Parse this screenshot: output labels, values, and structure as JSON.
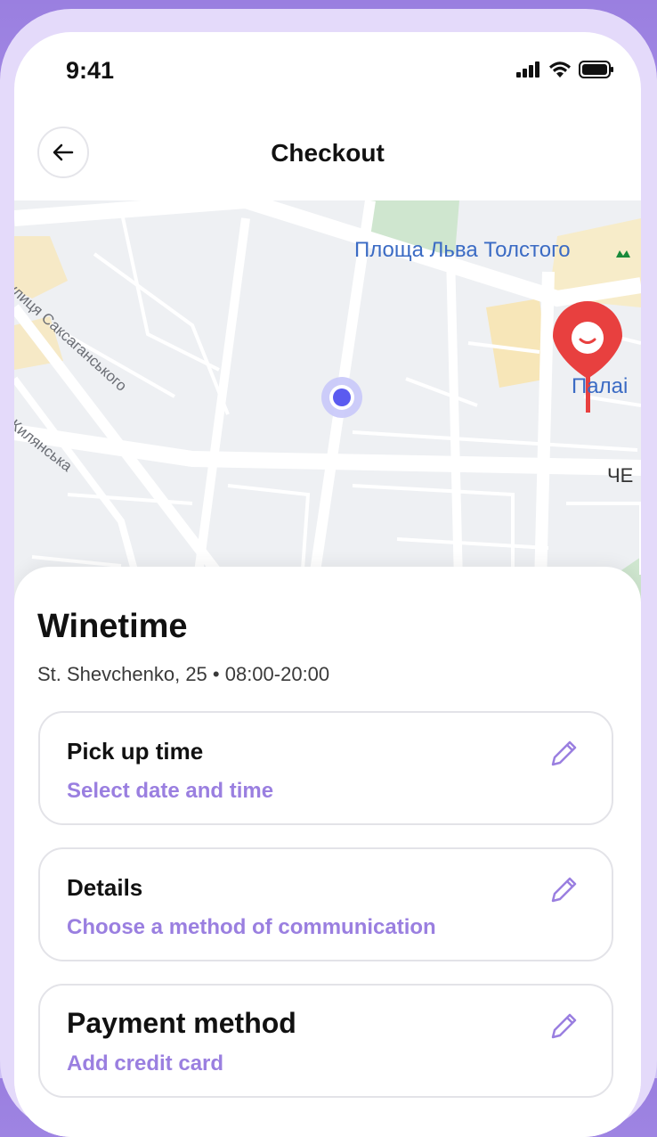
{
  "status_bar": {
    "time": "9:41",
    "icons": [
      "signal-icon",
      "wifi-icon",
      "battery-icon"
    ]
  },
  "header": {
    "title": "Checkout",
    "back_icon": "arrow-left-icon"
  },
  "map": {
    "labels": {
      "square": "Площа Льва Толстого",
      "street1": "вулиця Саксаганського",
      "street2": "я Жилянська",
      "building": "Палаі",
      "district": "ЧЕ"
    },
    "metro_icon": "metro-icon",
    "user_location_icon": "location-dot-icon",
    "store_pin_icon": "map-pin-icon"
  },
  "store": {
    "name": "Winetime",
    "info": "St. Shevchenko, 25 • 08:00-20:00"
  },
  "cards": [
    {
      "title": "Pick up time",
      "subtitle": "Select date and time",
      "edit_icon": "pencil-icon"
    },
    {
      "title": "Details",
      "subtitle": "Choose a method of communication",
      "edit_icon": "pencil-icon"
    },
    {
      "title": "Payment method",
      "subtitle": "Add credit card",
      "edit_icon": "pencil-icon"
    }
  ],
  "colors": {
    "accent": "#9a7fe0",
    "pin": "#e8403f",
    "map_link": "#3b6bc4",
    "location_dot": "#5b5bf0"
  }
}
